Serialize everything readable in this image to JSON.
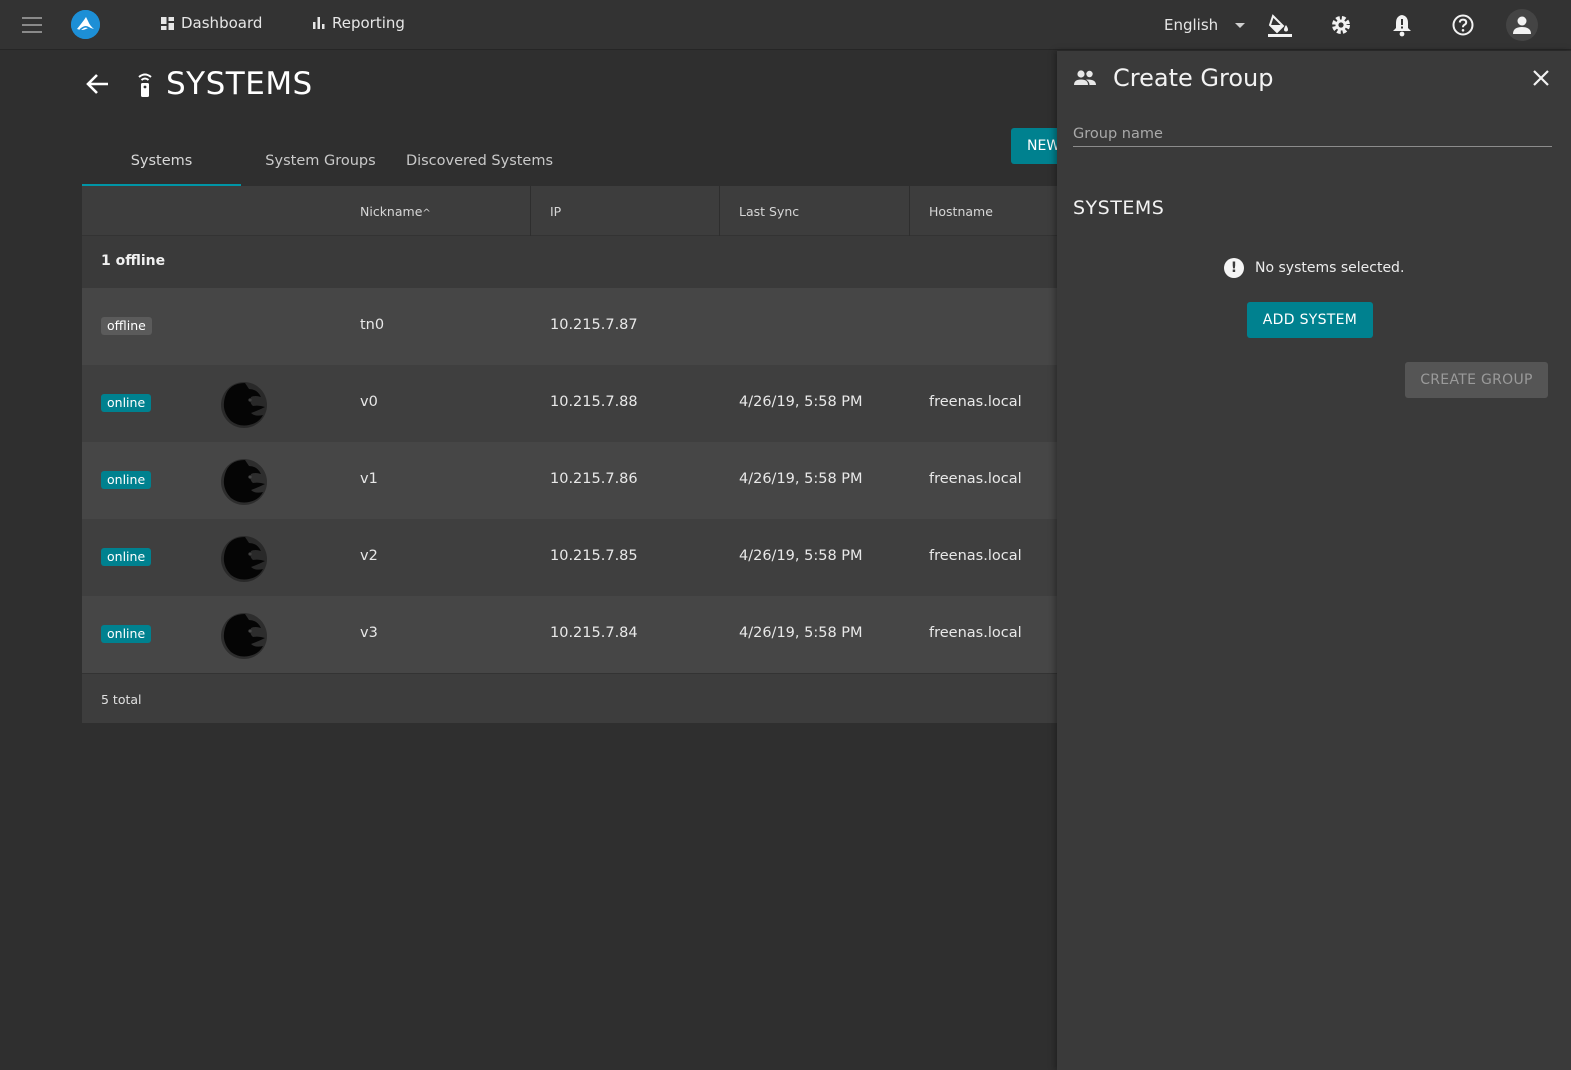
{
  "topbar": {
    "nav": [
      {
        "label": "Dashboard",
        "icon": "dashboard-icon"
      },
      {
        "label": "Reporting",
        "icon": "bar-chart-icon"
      }
    ],
    "language": "English",
    "icons": [
      "paint-bucket-icon",
      "gear-icon",
      "bell-alert-icon",
      "help-circle-icon",
      "account-icon"
    ]
  },
  "page": {
    "title": "SYSTEMS"
  },
  "tabs": [
    {
      "label": "Systems",
      "active": true
    },
    {
      "label": "System Groups",
      "active": false
    },
    {
      "label": "Discovered Systems",
      "active": false
    }
  ],
  "new_button": "NEW",
  "table": {
    "columns": [
      "Nickname",
      "IP",
      "Last Sync",
      "Hostname"
    ],
    "sort_indicator": "^",
    "group_label": "1 offline",
    "rows": [
      {
        "status": "offline",
        "nickname": "tn0",
        "ip": "10.215.7.87",
        "last_sync": "",
        "hostname": ""
      },
      {
        "status": "online",
        "nickname": "v0",
        "ip": "10.215.7.88",
        "last_sync": "4/26/19, 5:58 PM",
        "hostname": "freenas.local"
      },
      {
        "status": "online",
        "nickname": "v1",
        "ip": "10.215.7.86",
        "last_sync": "4/26/19, 5:58 PM",
        "hostname": "freenas.local"
      },
      {
        "status": "online",
        "nickname": "v2",
        "ip": "10.215.7.85",
        "last_sync": "4/26/19, 5:58 PM",
        "hostname": "freenas.local"
      },
      {
        "status": "online",
        "nickname": "v3",
        "ip": "10.215.7.84",
        "last_sync": "4/26/19, 5:58 PM",
        "hostname": "freenas.local"
      }
    ],
    "footer": "5 total"
  },
  "panel": {
    "title": "Create Group",
    "group_name_placeholder": "Group name",
    "systems_heading": "SYSTEMS",
    "empty_message": "No systems selected.",
    "add_system_label": "ADD SYSTEM",
    "create_group_label": "CREATE GROUP"
  },
  "colors": {
    "accent": "#00818f",
    "tab_indicator": "#0095a6",
    "logo": "#1d8fd6"
  }
}
